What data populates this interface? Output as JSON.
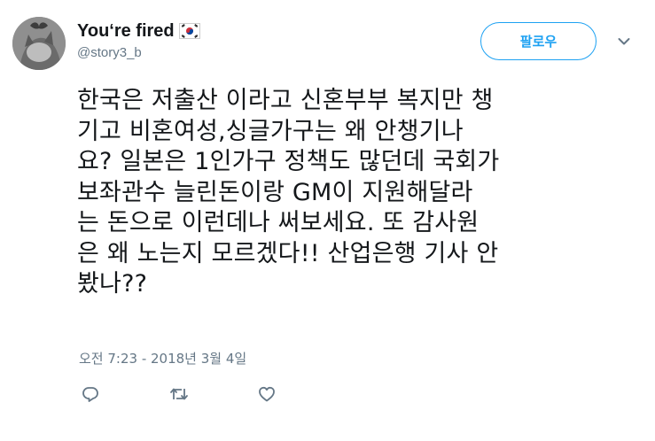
{
  "tweet": {
    "author": {
      "display_name": "You‘re fired",
      "handle": "@story3_b",
      "flag_icon": "south-korea-flag-icon",
      "avatar_icon": "cat-with-butterfly-avatar"
    },
    "follow_label": "팔로우",
    "text": "한국은 저출산 이라고 신혼부부 복지만 챙\n기고 비혼여성,싱글가구는 왜 안챙기나\n요? 일본은 1인가구 정책도 많던데 국회가\n보좌관수 늘린돈이랑 GM이 지원해달라\n는 돈으로 이런데나 써보세요. 또 감사원\n은 왜 노는지 모르겠다!! 산업은행 기사 안\n봤나??",
    "timestamp": "오전 7:23 - 2018년 3월 4일",
    "actions": [
      {
        "name": "reply",
        "icon": "reply-icon"
      },
      {
        "name": "retweet",
        "icon": "retweet-icon"
      },
      {
        "name": "like",
        "icon": "heart-icon"
      }
    ]
  },
  "colors": {
    "accent": "#1da1f2",
    "secondary_text": "#657786",
    "primary_text": "#14171a"
  }
}
